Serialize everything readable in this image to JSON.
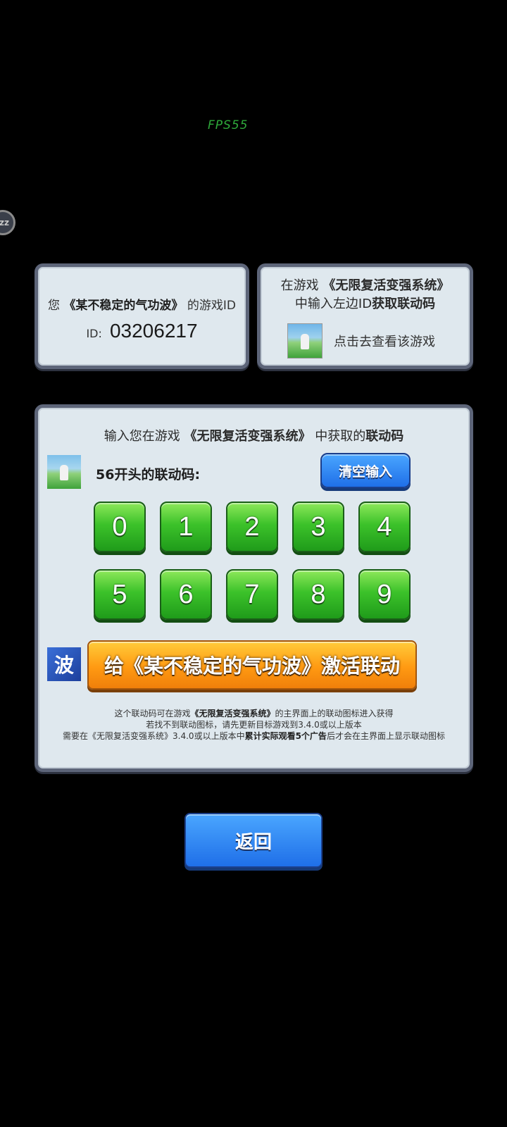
{
  "fps_label": "FPS55",
  "floating_button": "zz",
  "id_panel": {
    "prefix": "您",
    "game_name": "《某不稳定的气功波》",
    "suffix": "的游戏ID",
    "id_label": "ID:",
    "id_value": "03206217"
  },
  "link_panel": {
    "line1_prefix": "在游戏",
    "line1_game": "《无限复活变强系统》",
    "line2_prefix": "中输入左边ID",
    "line2_bold": "获取联动码",
    "view_game": "点击去查看该游戏"
  },
  "main_panel": {
    "title_prefix": "输入您在游戏",
    "title_game": "《无限复活变强系统》",
    "title_mid": "中获取的",
    "title_bold": "联动码",
    "code_prefix": "56开头的联动码:",
    "clear_button": "清空输入",
    "keys": [
      "0",
      "1",
      "2",
      "3",
      "4",
      "5",
      "6",
      "7",
      "8",
      "9"
    ],
    "activate_icon": "波",
    "activate_button": "给《某不稳定的气功波》激活联动",
    "footer": {
      "l1_a": "这个联动码可在游戏",
      "l1_b": "《无限复活变强系统》",
      "l1_c": "的主界面上的联动图标进入获得",
      "l2": "若找不到联动图标，请先更新目标游戏到3.4.0或以上版本",
      "l3_a": "需要在《无限复活变强系统》3.4.0或以上版本中",
      "l3_b": "累计实际观看5个广告",
      "l3_c": "后才会在主界面上显示联动图标"
    }
  },
  "back_button": "返回"
}
